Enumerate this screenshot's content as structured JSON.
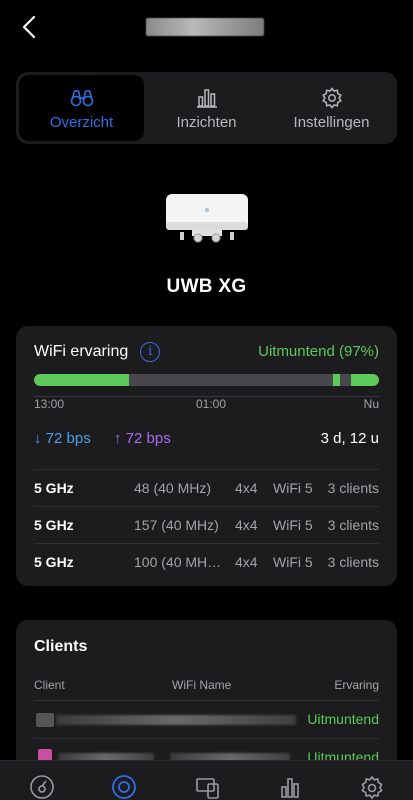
{
  "tabs": [
    {
      "label": "Overzicht",
      "icon": "binoculars-icon",
      "active": true
    },
    {
      "label": "Inzichten",
      "icon": "bar-chart-icon",
      "active": false
    },
    {
      "label": "Instellingen",
      "icon": "gear-icon",
      "active": false
    }
  ],
  "device": {
    "name": "UWB XG"
  },
  "wifi": {
    "title": "WiFi ervaring",
    "status": "Uitmuntend (97%)",
    "times": [
      "13:00",
      "01:00",
      "Nu"
    ],
    "download": "72 bps",
    "upload": "72 bps",
    "uptime": "3 d, 12 u",
    "radios": [
      {
        "band": "5 GHz",
        "channel": "48 (40 MHz)",
        "mimo": "4x4",
        "standard": "WiFi 5",
        "clients": "3 clients"
      },
      {
        "band": "5 GHz",
        "channel": "157 (40 MHz)",
        "mimo": "4x4",
        "standard": "WiFi 5",
        "clients": "3 clients"
      },
      {
        "band": "5 GHz",
        "channel": "100 (40 MH…",
        "mimo": "4x4",
        "standard": "WiFi 5",
        "clients": "3 clients"
      }
    ]
  },
  "clients": {
    "title": "Clients",
    "columns": [
      "Client",
      "WiFi Name",
      "Ervaring"
    ],
    "rows": [
      {
        "experience": "Uitmuntend"
      },
      {
        "experience": "Uitmuntend"
      }
    ]
  },
  "colors": {
    "accent": "#2f6fe4",
    "good": "#5cc95a",
    "download": "#4aa0e8",
    "upload": "#a66cf0"
  }
}
